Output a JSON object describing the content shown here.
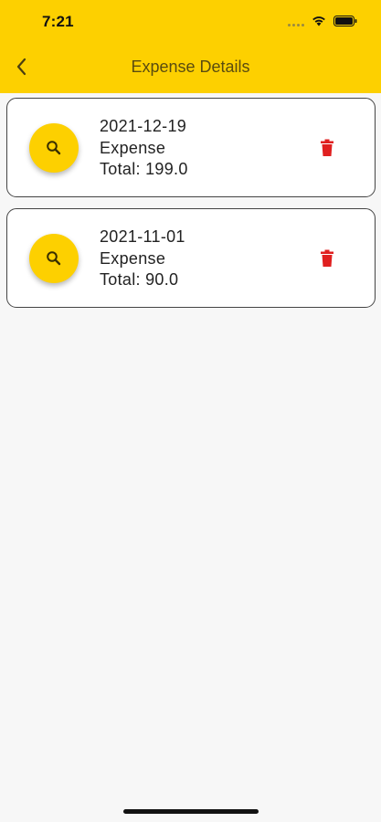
{
  "status_bar": {
    "time": "7:21"
  },
  "nav": {
    "title": "Expense Details",
    "back_icon": "chevron-left-icon"
  },
  "colors": {
    "accent": "#fdd000",
    "delete": "#e02020",
    "background": "#f7f7f7"
  },
  "expenses": [
    {
      "date": "2021-12-19",
      "type": "Expense",
      "total": "Total: 199.0"
    },
    {
      "date": "2021-11-01",
      "type": "Expense",
      "total": "Total: 90.0"
    }
  ]
}
